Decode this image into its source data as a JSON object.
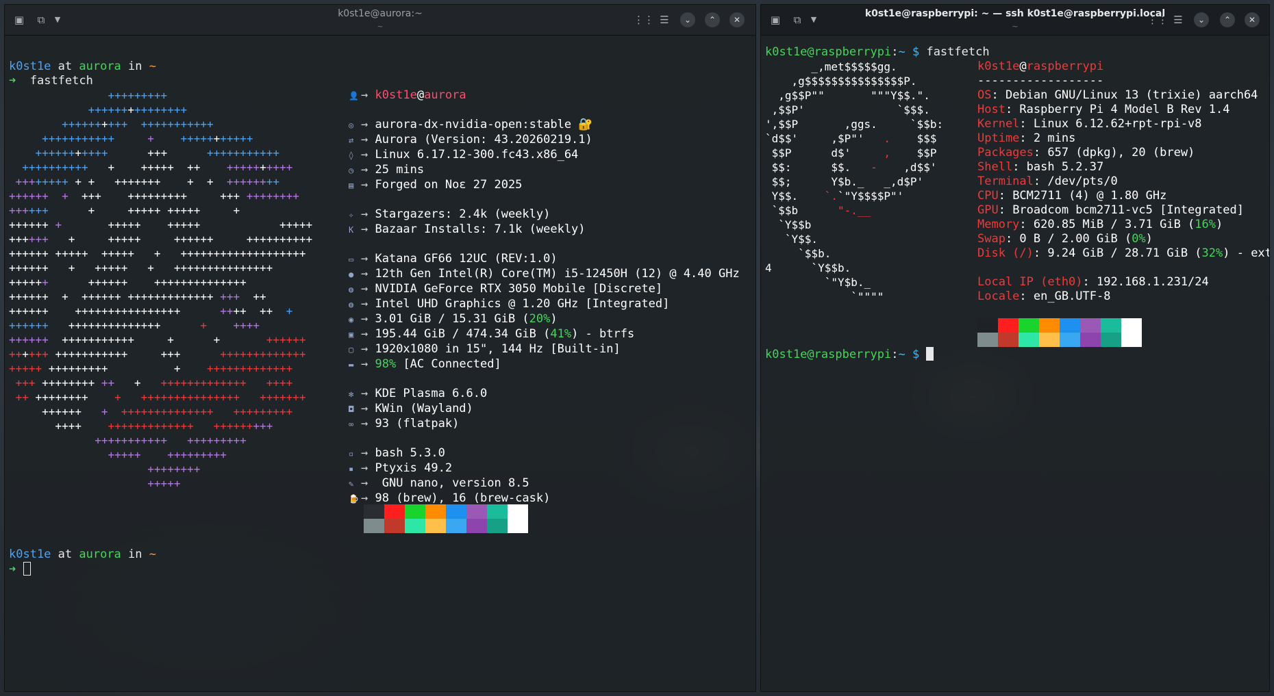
{
  "left_window": {
    "title": "k0st1e@aurora:~",
    "subtitle": "~",
    "prompt1": {
      "user": "k0st1e",
      "at": " at ",
      "host": "aurora",
      "in": " in ",
      "dir": "~"
    },
    "command": "fastfetch",
    "prompt2": {
      "user": "k0st1e",
      "at": " at ",
      "host": "aurora",
      "in": " in ",
      "dir": "~"
    },
    "arrow": "➜",
    "ascii_art": [
      [
        {
          "t": "               +++++++++",
          "c": "blue"
        }
      ],
      [
        {
          "t": "            ++++++",
          "c": "blue"
        },
        {
          "t": "+",
          "c": "white"
        },
        {
          "t": "++++++++",
          "c": "blue"
        }
      ],
      [
        {
          "t": "        ++++++",
          "c": "blue"
        },
        {
          "t": "+",
          "c": "white"
        },
        {
          "t": "+++  +++++++++++",
          "c": "blue"
        }
      ],
      [
        {
          "t": "     +++++++++++     ",
          "c": "blue"
        },
        {
          "t": "+",
          "c": "purple"
        },
        {
          "t": "    +++++",
          "c": "blue"
        },
        {
          "t": "+",
          "c": "white"
        },
        {
          "t": "+++++",
          "c": "blue"
        }
      ],
      [
        {
          "t": "    ++++++",
          "c": "blue"
        },
        {
          "t": "+",
          "c": "white"
        },
        {
          "t": "++++",
          "c": "blue"
        },
        {
          "t": "      +++      ",
          "c": "white"
        },
        {
          "t": "+++++++++++",
          "c": "blue"
        }
      ],
      [
        {
          "t": "  ++++++++++",
          "c": "blue"
        },
        {
          "t": "   +    +++++  ++    ",
          "c": "white"
        },
        {
          "t": "+++++",
          "c": "purple"
        },
        {
          "t": "+",
          "c": "white"
        },
        {
          "t": "++++",
          "c": "purple"
        }
      ],
      [
        {
          "t": " +++",
          "c": "purple"
        },
        {
          "t": "+++++",
          "c": "blue"
        },
        {
          "t": " + +   +++++++    +  +  ",
          "c": "white"
        },
        {
          "t": "++++++",
          "c": "purple"
        },
        {
          "t": "++",
          "c": "blue"
        }
      ],
      [
        {
          "t": "++++++  +",
          "c": "purple"
        },
        {
          "t": "  +++    +++++++++     +++ ",
          "c": "white"
        },
        {
          "t": "++++++++",
          "c": "purple"
        }
      ],
      [
        {
          "t": "+++",
          "c": "purple"
        },
        {
          "t": "+++",
          "c": "blue"
        },
        {
          "t": "      +     +++++ +++++     +",
          "c": "white"
        }
      ],
      [
        {
          "t": "++++++ ",
          "c": "white"
        },
        {
          "t": "+",
          "c": "purple"
        },
        {
          "t": "       +++++    +++++            +++++",
          "c": "white"
        }
      ],
      [
        {
          "t": "+++",
          "c": "white"
        },
        {
          "t": "+++",
          "c": "purple"
        },
        {
          "t": "   +     +++++     ++++++     ++++++++++",
          "c": "white"
        }
      ],
      [
        {
          "t": "++++++ +++++  +++++   +   +++++++++++++++++++",
          "c": "white"
        }
      ],
      [
        {
          "t": "++++++   +   +++++   +   +++++++++++++++",
          "c": "white"
        }
      ],
      [
        {
          "t": "+++++",
          "c": "white"
        },
        {
          "t": "+",
          "c": "purple"
        },
        {
          "t": "      ++++++    ++++++++++++++",
          "c": "white"
        }
      ],
      [
        {
          "t": "++++++  +  ++++++ +++++++++++++ ",
          "c": "white"
        },
        {
          "t": "+++",
          "c": "purple"
        },
        {
          "t": "  ++",
          "c": "white"
        }
      ],
      [
        {
          "t": "++++++    ++++++++++++++++      ",
          "c": "white"
        },
        {
          "t": "++",
          "c": "purple"
        },
        {
          "t": "++  ++  ",
          "c": "white"
        },
        {
          "t": "+",
          "c": "blue"
        }
      ],
      [
        {
          "t": "++++++",
          "c": "blue"
        },
        {
          "t": "   ++++++++++++++      ",
          "c": "white"
        },
        {
          "t": "+",
          "c": "red"
        },
        {
          "t": "    ",
          "c": "white"
        },
        {
          "t": "++++",
          "c": "purple"
        }
      ],
      [
        {
          "t": "++++++",
          "c": "purple"
        },
        {
          "t": "  +++++++++++     +      +       ",
          "c": "white"
        },
        {
          "t": "++++++",
          "c": "red"
        }
      ],
      [
        {
          "t": "++",
          "c": "red"
        },
        {
          "t": "+",
          "c": "white"
        },
        {
          "t": "+++",
          "c": "red"
        },
        {
          "t": " +++++++++++     +++      ",
          "c": "white"
        },
        {
          "t": "+++++++++++++",
          "c": "red"
        }
      ],
      [
        {
          "t": "+++++",
          "c": "red"
        },
        {
          "t": " +++++++++          +    ",
          "c": "white"
        },
        {
          "t": "+++++++++++++",
          "c": "red"
        }
      ],
      [
        {
          "t": " +++",
          "c": "red"
        },
        {
          "t": " ++++++++ ",
          "c": "white"
        },
        {
          "t": "++",
          "c": "purple"
        },
        {
          "t": "   +   ",
          "c": "white"
        },
        {
          "t": "+++++++++++++   ++++",
          "c": "red"
        }
      ],
      [
        {
          "t": " ++",
          "c": "red"
        },
        {
          "t": " ++++++++    ",
          "c": "white"
        },
        {
          "t": "+   +++++++++++++++   +++++++",
          "c": "red"
        }
      ],
      [
        {
          "t": "     ++++++   ",
          "c": "white"
        },
        {
          "t": "+",
          "c": "purple"
        },
        {
          "t": "  ++++++++++++++   +++++++++",
          "c": "red"
        }
      ],
      [
        {
          "t": "       ++++    ",
          "c": "white"
        },
        {
          "t": "+++++++++++++   ++++++",
          "c": "red"
        },
        {
          "t": "+++",
          "c": "purple"
        }
      ],
      [
        {
          "t": "             +++++++++++   +++++++++",
          "c": "purple"
        }
      ],
      [
        {
          "t": "               +++++    +++++++++",
          "c": "purple"
        }
      ],
      [
        {
          "t": "                     ++++++++",
          "c": "purple"
        }
      ],
      [
        {
          "t": "                     +++++",
          "c": "purple"
        }
      ]
    ],
    "info": [
      {
        "icon": "user-icon",
        "glyph": "👤",
        "parts": [
          {
            "t": "k0st1e",
            "c": "pink"
          },
          {
            "t": "@",
            "c": "white"
          },
          {
            "t": "aurora",
            "c": "pink"
          }
        ]
      },
      {
        "blank": true
      },
      {
        "icon": "os-icon",
        "glyph": "◎",
        "parts": [
          {
            "t": "aurora-dx-nvidia-open:stable 🔐",
            "c": "white"
          }
        ]
      },
      {
        "icon": "version-icon",
        "glyph": "⇄",
        "parts": [
          {
            "t": "Aurora (Version: 43.20260219.1)",
            "c": "white"
          }
        ]
      },
      {
        "icon": "kernel-icon",
        "glyph": "◊",
        "parts": [
          {
            "t": "Linux 6.17.12-300.fc43.x86_64",
            "c": "white"
          }
        ]
      },
      {
        "icon": "uptime-icon",
        "glyph": "◷",
        "parts": [
          {
            "t": "25 mins",
            "c": "white"
          }
        ]
      },
      {
        "icon": "calendar-icon",
        "glyph": "▤",
        "parts": [
          {
            "t": "Forged on Noɛ 27 2025",
            "c": "white"
          }
        ]
      },
      {
        "blank": true
      },
      {
        "icon": "star-icon",
        "glyph": "✧",
        "parts": [
          {
            "t": "Stargazers: 2.4k (weekly)",
            "c": "white"
          }
        ]
      },
      {
        "icon": "bazaar-icon",
        "glyph": "K",
        "parts": [
          {
            "t": "Bazaar Installs: 7.1k (weekly)",
            "c": "white"
          }
        ]
      },
      {
        "blank": true
      },
      {
        "icon": "laptop-icon",
        "glyph": "▭",
        "parts": [
          {
            "t": "Katana GF66 12UC (REV:1.0)",
            "c": "white"
          }
        ]
      },
      {
        "icon": "cpu-icon",
        "glyph": "●",
        "parts": [
          {
            "t": "12th Gen Intel(R) Core(TM) i5-12450H (12) @ 4.40 GHz",
            "c": "white"
          }
        ]
      },
      {
        "icon": "gpu-icon",
        "glyph": "◍",
        "parts": [
          {
            "t": "NVIDIA GeForce RTX 3050 Mobile [Discrete]",
            "c": "white"
          }
        ]
      },
      {
        "icon": "gpu-icon",
        "glyph": "◍",
        "parts": [
          {
            "t": "Intel UHD Graphics @ 1.20 GHz [Integrated]",
            "c": "white"
          }
        ]
      },
      {
        "icon": "memory-icon",
        "glyph": "◉",
        "parts": [
          {
            "t": "3.01 GiB / 15.31 GiB (",
            "c": "white"
          },
          {
            "t": "20%",
            "c": "green"
          },
          {
            "t": ")",
            "c": "white"
          }
        ]
      },
      {
        "icon": "disk-icon",
        "glyph": "▣",
        "parts": [
          {
            "t": "195.44 GiB / 474.34 GiB (",
            "c": "white"
          },
          {
            "t": "41%",
            "c": "green"
          },
          {
            "t": ") - btrfs",
            "c": "white"
          }
        ]
      },
      {
        "icon": "display-icon",
        "glyph": "▢",
        "parts": [
          {
            "t": "1920x1080 in 15\", 144 Hz [Built-in]",
            "c": "white"
          }
        ]
      },
      {
        "icon": "battery-icon",
        "glyph": "▬",
        "parts": [
          {
            "t": "98%",
            "c": "green"
          },
          {
            "t": " [AC Connected]",
            "c": "white"
          }
        ]
      },
      {
        "blank": true
      },
      {
        "icon": "kde-icon",
        "glyph": "✻",
        "parts": [
          {
            "t": "KDE Plasma 6.6.0",
            "c": "white"
          }
        ]
      },
      {
        "icon": "window-icon",
        "glyph": "◘",
        "parts": [
          {
            "t": "KWin (Wayland)",
            "c": "white"
          }
        ]
      },
      {
        "icon": "package-icon",
        "glyph": "∞",
        "parts": [
          {
            "t": "93 (flatpak)",
            "c": "white"
          }
        ]
      },
      {
        "blank": true
      },
      {
        "icon": "shell-icon",
        "glyph": "▫",
        "parts": [
          {
            "t": "bash 5.3.0",
            "c": "white"
          }
        ]
      },
      {
        "icon": "terminal-icon",
        "glyph": "▪",
        "parts": [
          {
            "t": "Ptyxis 49.2",
            "c": "white"
          }
        ]
      },
      {
        "icon": "editor-icon",
        "glyph": "✎",
        "parts": [
          {
            "t": " GNU nano, version 8.5",
            "c": "white"
          }
        ]
      },
      {
        "icon": "brew-icon",
        "glyph": "🍺",
        "parts": [
          {
            "t": "98 (brew), 16 (brew-cask)",
            "c": "white"
          }
        ]
      }
    ],
    "info_arrow": "→",
    "swatches_top": [
      "#2a2e33",
      "#ff1e1e",
      "#19d42d",
      "#ff8c00",
      "#1e90f0",
      "#9b59b6",
      "#1abc9c",
      "#ffffff"
    ],
    "swatches_bottom": [
      "#7f8c8d",
      "#c0392b",
      "#2ee6a6",
      "#ffc04a",
      "#3aa8f0",
      "#8e44ad",
      "#16a085",
      "#ffffff"
    ]
  },
  "right_window": {
    "title": "k0st1e@raspberrypi: ~ — ssh k0st1e@raspberrypi.local",
    "subtitle": "~",
    "prompt": {
      "user": "k0st1e@raspberrypi",
      "colon": ":",
      "dir": "~",
      "dollar": " $ "
    },
    "command": "fastfetch",
    "ascii_art": [
      [
        {
          "t": "       _,met$$$$$gg.",
          "c": "white"
        }
      ],
      [
        {
          "t": "    ,g$$$$$$$$$$$$$$$P.",
          "c": "white"
        }
      ],
      [
        {
          "t": "  ,g$$P\"\"       \"\"\"Y$$.\".",
          "c": "white"
        }
      ],
      [
        {
          "t": " ,$$P'              `$$$.",
          "c": "white"
        }
      ],
      [
        {
          "t": "',$$P       ,ggs.     `$$b:",
          "c": "white"
        }
      ],
      [
        {
          "t": "`d$$'     ,$P\"'   ",
          "c": "white"
        },
        {
          "t": ".",
          "c": "red"
        },
        {
          "t": "    $$$",
          "c": "white"
        }
      ],
      [
        {
          "t": " $$P      d$'     ",
          "c": "white"
        },
        {
          "t": ",",
          "c": "red"
        },
        {
          "t": "    $$P",
          "c": "white"
        }
      ],
      [
        {
          "t": " $$:      $$.   ",
          "c": "white"
        },
        {
          "t": "-",
          "c": "red"
        },
        {
          "t": "    ,d$$'",
          "c": "white"
        }
      ],
      [
        {
          "t": " $$;      Y$b._   _,d$P'",
          "c": "white"
        }
      ],
      [
        {
          "t": " Y$$.    ",
          "c": "white"
        },
        {
          "t": "`.",
          "c": "red"
        },
        {
          "t": "`\"Y$$$$P\"'",
          "c": "white"
        }
      ],
      [
        {
          "t": " `$$b      ",
          "c": "white"
        },
        {
          "t": "\"-.__",
          "c": "red"
        }
      ],
      [
        {
          "t": "  `Y$$b",
          "c": "white"
        }
      ],
      [
        {
          "t": "   `Y$$.",
          "c": "white"
        }
      ],
      [
        {
          "t": "     `$$b.",
          "c": "white"
        }
      ],
      [
        {
          "t": "4      `Y$$b.",
          "c": "white"
        }
      ],
      [
        {
          "t": "         `\"Y$b._",
          "c": "white"
        }
      ],
      [
        {
          "t": "             `\"\"\"\"",
          "c": "white"
        }
      ]
    ],
    "info": [
      {
        "parts": [
          {
            "t": "k0st1e",
            "c": "red"
          },
          {
            "t": "@",
            "c": "white"
          },
          {
            "t": "raspberrypi",
            "c": "red"
          }
        ]
      },
      {
        "parts": [
          {
            "t": "------------------",
            "c": "white"
          }
        ]
      },
      {
        "parts": [
          {
            "t": "OS",
            "c": "red"
          },
          {
            "t": ": Debian GNU/Linux 13 (trixie) aarch64",
            "c": "white"
          }
        ]
      },
      {
        "parts": [
          {
            "t": "Host",
            "c": "red"
          },
          {
            "t": ": Raspberry Pi 4 Model B Rev 1.4",
            "c": "white"
          }
        ]
      },
      {
        "parts": [
          {
            "t": "Kernel",
            "c": "red"
          },
          {
            "t": ": Linux 6.12.62+rpt-rpi-v8",
            "c": "white"
          }
        ]
      },
      {
        "parts": [
          {
            "t": "Uptime",
            "c": "red"
          },
          {
            "t": ": 2 mins",
            "c": "white"
          }
        ]
      },
      {
        "parts": [
          {
            "t": "Packages",
            "c": "red"
          },
          {
            "t": ": 657 (dpkg), 20 (brew)",
            "c": "white"
          }
        ]
      },
      {
        "parts": [
          {
            "t": "Shell",
            "c": "red"
          },
          {
            "t": ": bash 5.2.37",
            "c": "white"
          }
        ]
      },
      {
        "parts": [
          {
            "t": "Terminal",
            "c": "red"
          },
          {
            "t": ": /dev/pts/0",
            "c": "white"
          }
        ]
      },
      {
        "parts": [
          {
            "t": "CPU",
            "c": "red"
          },
          {
            "t": ": BCM2711 (4) @ 1.80 GHz",
            "c": "white"
          }
        ]
      },
      {
        "parts": [
          {
            "t": "GPU",
            "c": "red"
          },
          {
            "t": ": Broadcom bcm2711-vc5 [Integrated]",
            "c": "white"
          }
        ]
      },
      {
        "parts": [
          {
            "t": "Memory",
            "c": "red"
          },
          {
            "t": ": 620.85 MiB / 3.71 GiB (",
            "c": "white"
          },
          {
            "t": "16%",
            "c": "green"
          },
          {
            "t": ")",
            "c": "white"
          }
        ]
      },
      {
        "parts": [
          {
            "t": "Swap",
            "c": "red"
          },
          {
            "t": ": 0 B / 2.00 GiB (",
            "c": "white"
          },
          {
            "t": "0%",
            "c": "green"
          },
          {
            "t": ")",
            "c": "white"
          }
        ]
      },
      {
        "parts": [
          {
            "t": "Disk (/)",
            "c": "red"
          },
          {
            "t": ": 9.24 GiB / 28.71 GiB (",
            "c": "white"
          },
          {
            "t": "32%",
            "c": "green"
          },
          {
            "t": ") - ext",
            "c": "white"
          }
        ]
      },
      {
        "blank": true
      },
      {
        "parts": [
          {
            "t": "Local IP (eth0)",
            "c": "red"
          },
          {
            "t": ": 192.168.1.231/24",
            "c": "white"
          }
        ]
      },
      {
        "parts": [
          {
            "t": "Locale",
            "c": "red"
          },
          {
            "t": ": en_GB.UTF-8",
            "c": "white"
          }
        ]
      }
    ],
    "swatches_top": [
      "#1e2226",
      "#ff1e1e",
      "#19d42d",
      "#ff8c00",
      "#1e90f0",
      "#9b59b6",
      "#1abc9c",
      "#ffffff"
    ],
    "swatches_bottom": [
      "#7f8c8d",
      "#c0392b",
      "#2ee6a6",
      "#ffc04a",
      "#3aa8f0",
      "#8e44ad",
      "#16a085",
      "#ffffff"
    ]
  },
  "colors": {
    "blue": "#4ea3f2",
    "green": "#43d65a",
    "orange": "#f6983b",
    "red": "#ef3a3a",
    "purple": "#b777e6",
    "white": "#ffffff",
    "pink": "#ff4d6d",
    "cyan": "#3ab8ff"
  }
}
